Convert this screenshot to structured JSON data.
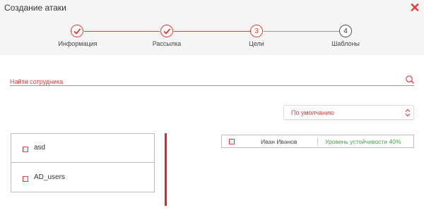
{
  "dialog": {
    "title": "Создание атаки"
  },
  "stepper": {
    "steps": [
      {
        "label": "Информация",
        "state": "done"
      },
      {
        "label": "Рассылка",
        "state": "done"
      },
      {
        "label": "Цели",
        "number": "3",
        "state": "current"
      },
      {
        "label": "Шаблоны",
        "number": "4",
        "state": "todo"
      }
    ]
  },
  "search": {
    "placeholder": "Найти сотрудника",
    "icon": "search-icon"
  },
  "sort": {
    "selected": "По умолчанию"
  },
  "groups": [
    {
      "label": "asd"
    },
    {
      "label": "AD_users"
    }
  ],
  "employees": [
    {
      "name": "Иван Иванов",
      "status": "Уровень устойчивости 40%"
    }
  ],
  "colors": {
    "accent": "#e53935",
    "divider": "#e8202a",
    "status_ok": "#43a047",
    "header_bg": "#f5f5f5"
  }
}
